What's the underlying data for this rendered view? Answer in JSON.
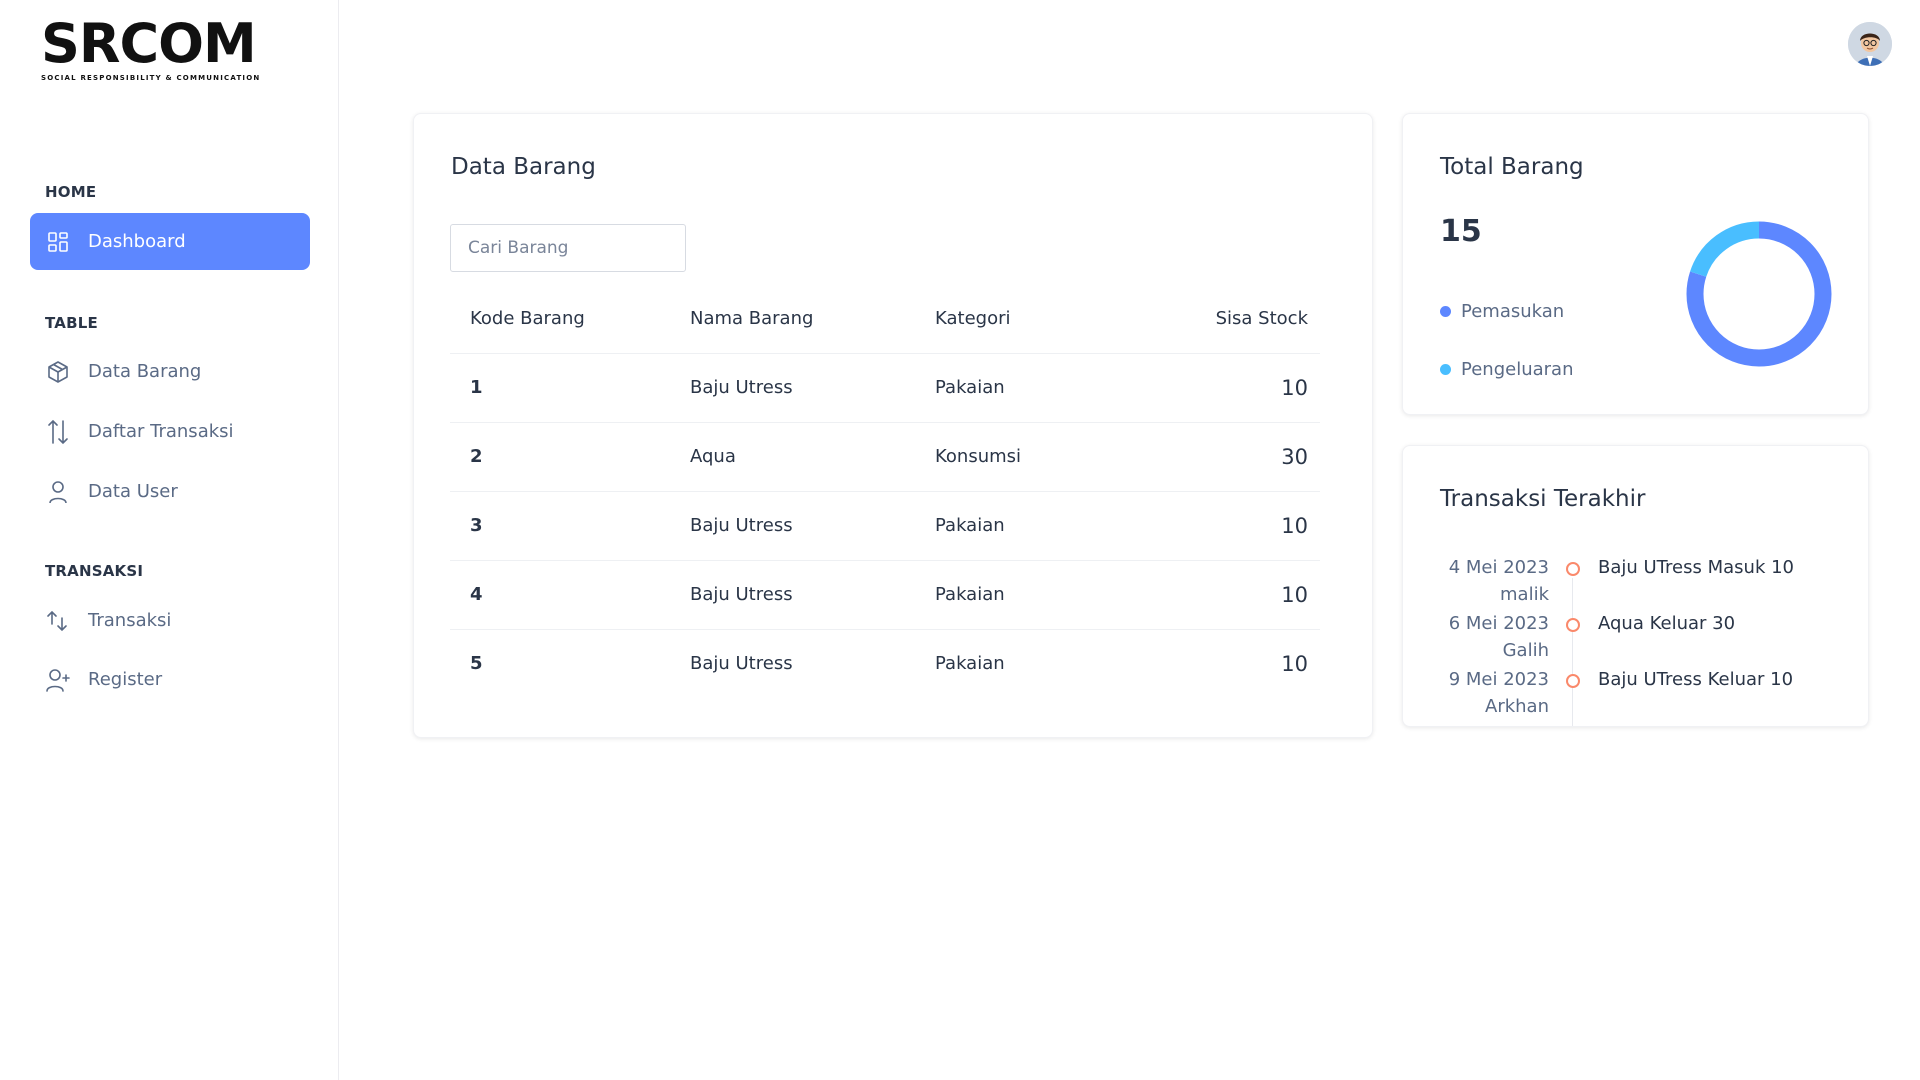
{
  "brand": {
    "name": "SRCOM",
    "tagline": "Social Responsibility & Communication"
  },
  "sidebar": {
    "sections": [
      {
        "title": "HOME",
        "items": [
          {
            "label": "Dashboard",
            "icon": "dashboard-grid-icon",
            "active": true
          }
        ]
      },
      {
        "title": "TABLE",
        "items": [
          {
            "label": "Data Barang",
            "icon": "box-icon"
          },
          {
            "label": "Daftar Transaksi",
            "icon": "sort-arrows-icon"
          },
          {
            "label": "Data User",
            "icon": "user-icon"
          }
        ]
      },
      {
        "title": "TRANSAKSI",
        "items": [
          {
            "label": "Transaksi",
            "icon": "transfer-arrows-icon"
          },
          {
            "label": "Register",
            "icon": "user-plus-icon"
          }
        ]
      }
    ]
  },
  "header": {
    "avatar": "user-avatar"
  },
  "data_barang": {
    "title": "Data Barang",
    "search_placeholder": "Cari Barang",
    "columns": [
      "Kode Barang",
      "Nama Barang",
      "Kategori",
      "Sisa Stock"
    ],
    "rows": [
      {
        "kode": "1",
        "nama": "Baju Utress",
        "kategori": "Pakaian",
        "stock": "10"
      },
      {
        "kode": "2",
        "nama": "Aqua",
        "kategori": "Konsumsi",
        "stock": "30"
      },
      {
        "kode": "3",
        "nama": "Baju Utress",
        "kategori": "Pakaian",
        "stock": "10"
      },
      {
        "kode": "4",
        "nama": "Baju Utress",
        "kategori": "Pakaian",
        "stock": "10"
      },
      {
        "kode": "5",
        "nama": "Baju Utress",
        "kategori": "Pakaian",
        "stock": "10"
      }
    ]
  },
  "total_barang": {
    "title": "Total Barang",
    "value": "15",
    "legend": [
      {
        "label": "Pemasukan",
        "color": "#5d87ff"
      },
      {
        "label": "Pengeluaran",
        "color": "#49beff"
      }
    ]
  },
  "chart_data": {
    "type": "pie",
    "title": "",
    "categories": [
      "Pemasukan",
      "Pengeluaran"
    ],
    "values": [
      0.8,
      0.2
    ],
    "colors": [
      "#5d87ff",
      "#49beff"
    ]
  },
  "transaksi_terakhir": {
    "title": "Transaksi Terakhir",
    "items": [
      {
        "date": "4 Mei 2023",
        "user": "malik",
        "text": "Baju UTress Masuk 10"
      },
      {
        "date": "6 Mei 2023",
        "user": "Galih",
        "text": "Aqua Keluar 30"
      },
      {
        "date": "9 Mei 2023",
        "user": "Arkhan",
        "text": "Baju UTress Keluar 10"
      }
    ]
  }
}
